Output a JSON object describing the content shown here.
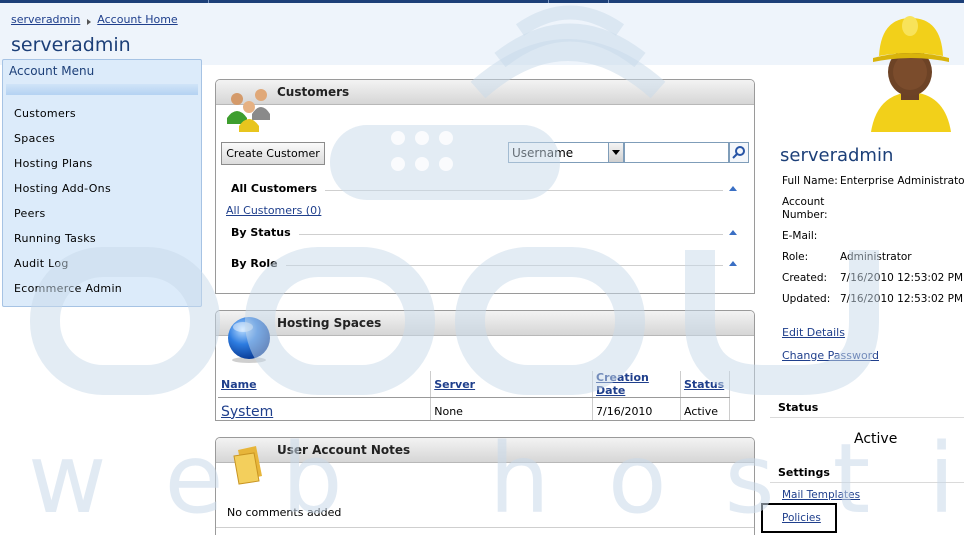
{
  "breadcrumb": {
    "root": "serveradmin",
    "current": "Account Home"
  },
  "page_title": "serveradmin",
  "menu": {
    "title": "Account Menu",
    "items": [
      "Customers",
      "Spaces",
      "Hosting Plans",
      "Hosting Add-Ons",
      "Peers",
      "Running Tasks",
      "Audit Log",
      "Ecommerce Admin"
    ]
  },
  "customers": {
    "title": "Customers",
    "create_button": "Create Customer",
    "search_field": "Username",
    "search_value": "",
    "sections": {
      "all": "All Customers",
      "all_link": "All Customers (0)",
      "by_status": "By Status",
      "by_role": "By Role"
    }
  },
  "spaces": {
    "title": "Hosting Spaces",
    "columns": [
      "Name",
      "Server",
      "Creation Date",
      "Status"
    ],
    "rows": [
      {
        "name": "System",
        "server": "None",
        "created": "7/16/2010",
        "status": "Active"
      }
    ]
  },
  "notes": {
    "title": "User Account Notes",
    "empty_text": "No comments added"
  },
  "profile": {
    "name": "serveradmin",
    "full_name_label": "Full Name:",
    "full_name": "Enterprise Administrator",
    "account_number_label": "Account Number:",
    "account_number": "",
    "email_label": "E-Mail:",
    "email": "",
    "role_label": "Role:",
    "role": "Administrator",
    "created_label": "Created:",
    "created": "7/16/2010 12:53:02 PM",
    "updated_label": "Updated:",
    "updated": "7/16/2010 12:53:02 PM",
    "edit_details": "Edit Details",
    "change_password": "Change Password",
    "status_heading": "Status",
    "status_value": "Active",
    "settings_heading": "Settings",
    "mail_templates": "Mail Templates",
    "policies": "Policies"
  },
  "watermark": {
    "brand": "accu",
    "tagline": "web hosting"
  },
  "colors": {
    "accent": "#1c3f78",
    "link": "#1f3f8c",
    "menu_bg": "#dcebfa",
    "watermark": "#c8d9ea"
  }
}
